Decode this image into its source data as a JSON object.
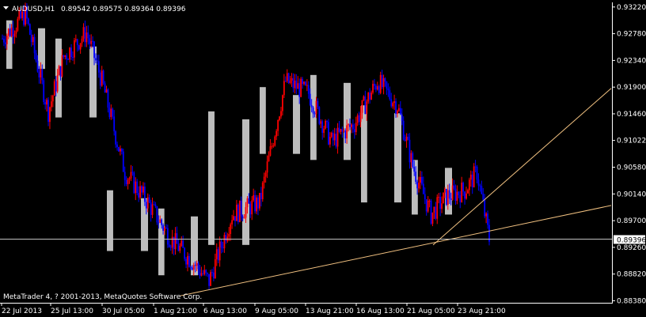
{
  "header": {
    "menu_icon": "triangle-down-icon",
    "symbol_tf": "AUDUSD,H1",
    "ohlc": "0.89542 0.89575 0.89364 0.89396"
  },
  "footer": {
    "copyright": "MetaTrader 4, ? 2001-2013, MetaQuotes Software Corp."
  },
  "colors": {
    "background": "#000000",
    "foreground": "#ffffff",
    "bull": "#ff0000",
    "bear": "#0000ff",
    "box": "#bdbdbd",
    "trendline": "#f0c080",
    "bidline": "#c0c0c0"
  },
  "chart_data": {
    "type": "candlestick",
    "symbol": "AUDUSD",
    "timeframe": "H1",
    "ylim": [
      0.8836,
      0.9327
    ],
    "y_ticks": [
      "0.93220",
      "0.92780",
      "0.92340",
      "0.91900",
      "0.91460",
      "0.91022",
      "0.90580",
      "0.90140",
      "0.89700",
      "0.89260",
      "0.88820",
      "0.88380"
    ],
    "x_ticks": [
      "22 Jul 2013",
      "25 Jul 13:00",
      "30 Jul 05:00",
      "1 Aug 21:00",
      "6 Aug 13:00",
      "9 Aug 05:00",
      "13 Aug 21:00",
      "16 Aug 13:00",
      "21 Aug 05:00",
      "23 Aug 21:00"
    ],
    "current_price": "0.89396",
    "anchors": [
      {
        "i": 0,
        "p": 0.927
      },
      {
        "i": 15,
        "p": 0.931
      },
      {
        "i": 30,
        "p": 0.915
      },
      {
        "i": 40,
        "p": 0.924
      },
      {
        "i": 55,
        "p": 0.928
      },
      {
        "i": 65,
        "p": 0.92
      },
      {
        "i": 80,
        "p": 0.905
      },
      {
        "i": 95,
        "p": 0.9
      },
      {
        "i": 110,
        "p": 0.894
      },
      {
        "i": 125,
        "p": 0.89
      },
      {
        "i": 135,
        "p": 0.887
      },
      {
        "i": 150,
        "p": 0.898
      },
      {
        "i": 168,
        "p": 0.9
      },
      {
        "i": 185,
        "p": 0.92
      },
      {
        "i": 200,
        "p": 0.918
      },
      {
        "i": 215,
        "p": 0.91
      },
      {
        "i": 230,
        "p": 0.913
      },
      {
        "i": 245,
        "p": 0.92
      },
      {
        "i": 258,
        "p": 0.916
      },
      {
        "i": 268,
        "p": 0.906
      },
      {
        "i": 280,
        "p": 0.898
      },
      {
        "i": 290,
        "p": 0.901
      },
      {
        "i": 302,
        "p": 0.902
      },
      {
        "i": 310,
        "p": 0.905
      },
      {
        "i": 318,
        "p": 0.894
      }
    ],
    "highlight_boxes": [
      {
        "x0": "22 Jul 2013",
        "x1": "25 Jul 13:00",
        "p_lo": 0.922,
        "p_hi": 0.93
      },
      {
        "x0": "25 Jul 13:00",
        "x1": "30 Jul 05:00",
        "p_lo": 0.914,
        "p_hi": 0.927
      },
      {
        "x0": "30 Jul 05:00",
        "x1": "1 Aug 21:00",
        "p_lo": 0.892,
        "p_hi": 0.902
      },
      {
        "x0": "1 Aug 21:00",
        "x1": "6 Aug 13:00",
        "p_lo": 0.888,
        "p_hi": 0.899
      },
      {
        "x0": "6 Aug 13:00",
        "x1": "9 Aug 05:00",
        "p_lo": 0.893,
        "p_hi": 0.915
      },
      {
        "x0": "9 Aug 05:00",
        "x1": "13 Aug 21:00",
        "p_lo": 0.908,
        "p_hi": 0.919
      },
      {
        "x0": "13 Aug 21:00",
        "x1": "16 Aug 13:00",
        "p_lo": 0.907,
        "p_hi": 0.921
      },
      {
        "x0": "16 Aug 13:00",
        "x1": "21 Aug 05:00",
        "p_lo": 0.9,
        "p_hi": 0.916
      },
      {
        "x0": "21 Aug 05:00",
        "x1": "23 Aug 21:00",
        "p_lo": 0.898,
        "p_hi": 0.907
      }
    ],
    "trendlines": [
      {
        "x0": "1 Aug 21:00",
        "p0": 0.8846,
        "x1": "end",
        "p1": 0.8995
      },
      {
        "x0": "21 Aug 05:00",
        "p0": 0.893,
        "x1": "end",
        "p1": 0.9188
      }
    ]
  }
}
